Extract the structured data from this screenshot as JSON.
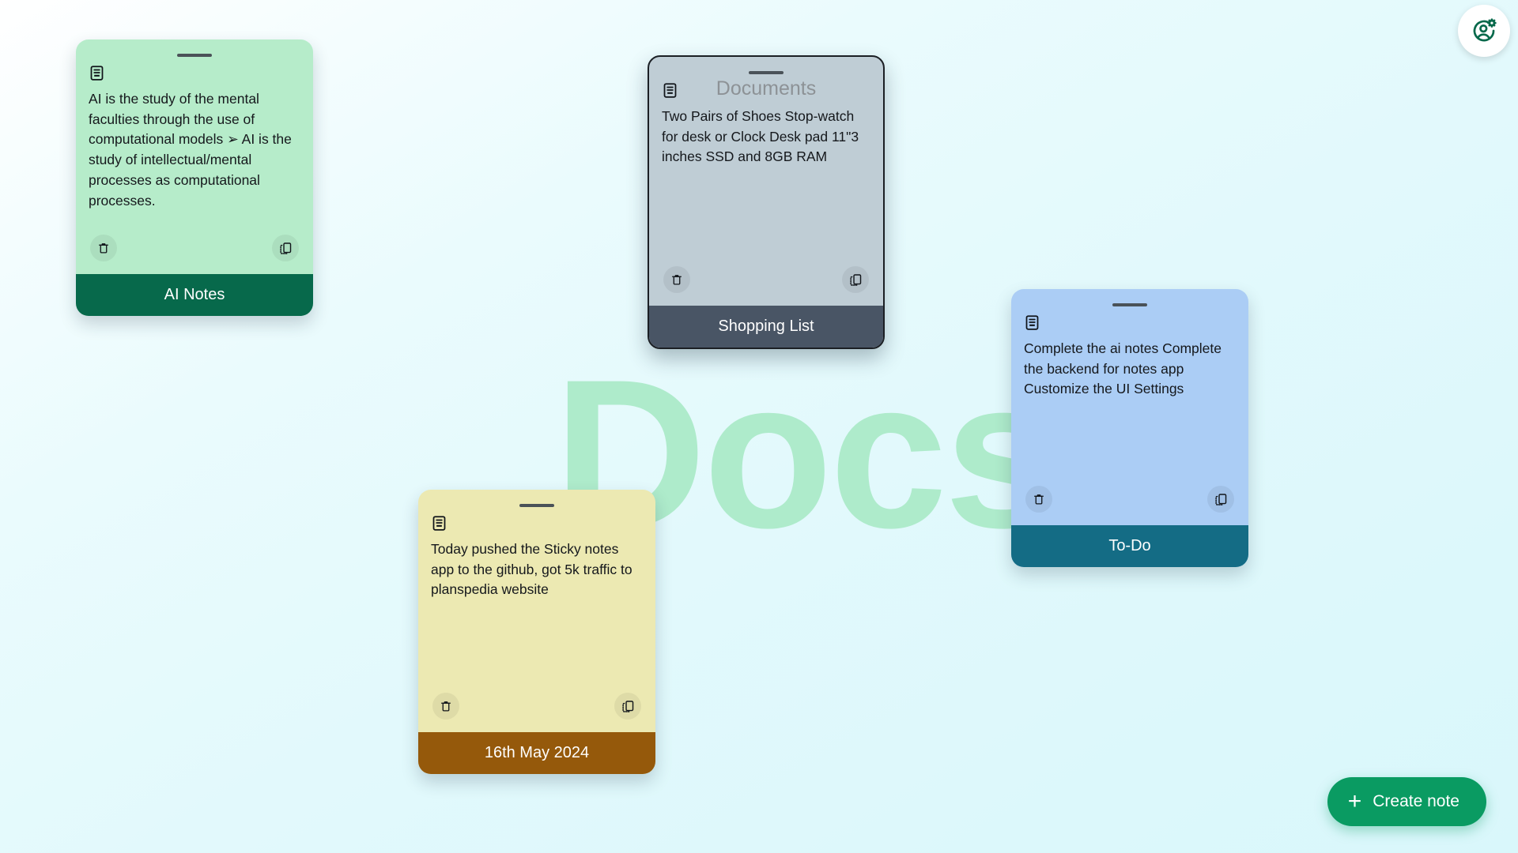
{
  "app": {
    "watermark": "Docs.",
    "brand_accent": "#0a9b62",
    "background_color": "#e2f9fc"
  },
  "header": {
    "profile_button": {
      "icon": "user-settings-icon",
      "color": "#07694b"
    }
  },
  "notes": [
    {
      "id": "ai-notes",
      "footer_label": "AI Notes",
      "text": "AI is the study of the mental faculties through the use of computational models ➢ AI is the study of intellectual/mental processes as computational processes.",
      "placeholder": "",
      "selected": false,
      "body_color": "#b6ecca",
      "footer_color": "#07694b",
      "delete_icon": "trash-icon",
      "copy_icon": "copy-icon",
      "doc_icon": "document-icon",
      "drag_handle": "drag-handle"
    },
    {
      "id": "shopping-list",
      "footer_label": "Shopping List",
      "text": "Two Pairs of Shoes Stop-watch for desk or Clock Desk pad 11\"3 inches SSD and 8GB RAM",
      "placeholder": "Documents",
      "selected": true,
      "body_color": "#bfcdd5",
      "footer_color": "#495565",
      "delete_icon": "trash-icon",
      "copy_icon": "copy-icon",
      "doc_icon": "document-icon",
      "drag_handle": "drag-handle"
    },
    {
      "id": "todo",
      "footer_label": "To-Do",
      "text": "Complete the ai notes Complete the backend for notes app Customize the UI Settings",
      "placeholder": "",
      "selected": false,
      "body_color": "#abcdf5",
      "footer_color": "#146c85",
      "delete_icon": "trash-icon",
      "copy_icon": "copy-icon",
      "doc_icon": "document-icon",
      "drag_handle": "drag-handle"
    },
    {
      "id": "date",
      "footer_label": "16th May 2024",
      "text": "Today pushed the Sticky notes app to the github, got 5k traffic to planspedia website",
      "placeholder": "",
      "selected": false,
      "body_color": "#ece9b2",
      "footer_color": "#95590b",
      "delete_icon": "trash-icon",
      "copy_icon": "copy-icon",
      "doc_icon": "document-icon",
      "drag_handle": "drag-handle"
    }
  ],
  "create_note": {
    "label": "Create note",
    "plus_glyph": "+",
    "icon": "plus-icon"
  }
}
